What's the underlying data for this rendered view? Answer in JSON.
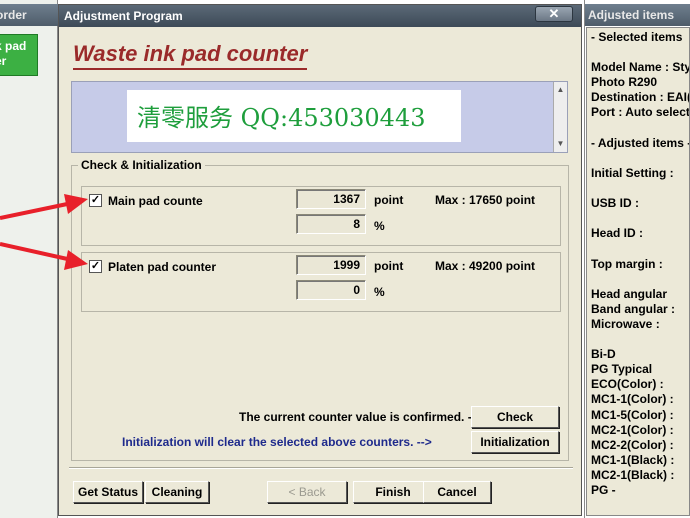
{
  "left_window": {
    "title": "order",
    "green_button_lines": [
      "k pad",
      "er"
    ]
  },
  "dialog": {
    "title": "Adjustment Program",
    "close_glyph": "✕",
    "heading": "Waste ink pad counter",
    "info_text": "清零服务 QQ:453030443",
    "check_group_label": "Check & Initialization",
    "main_pad": {
      "checked": true,
      "label": "Main pad counte",
      "point_value": "1367",
      "point_unit": "point",
      "percent_value": "8",
      "percent_unit": "%",
      "max": "Max : 17650 point"
    },
    "platen_pad": {
      "checked": true,
      "label": "Platen pad counter",
      "point_value": "1999",
      "point_unit": "point",
      "percent_value": "0",
      "percent_unit": "%",
      "max": "Max : 49200 point"
    },
    "confirm_text": "The current counter value is confirmed. -->",
    "init_text": "Initialization will clear the selected above counters. -->",
    "buttons": {
      "check": "Check",
      "initialization": "Initialization",
      "get_status": "Get Status",
      "cleaning": "Cleaning",
      "back": "< Back",
      "finish": "Finish",
      "cancel": "Cancel"
    }
  },
  "right_window": {
    "title": "Adjusted items",
    "lines": [
      "- Selected items",
      "Model Name : Sty",
      "Photo R290",
      "Destination : EAI(",
      "Port : Auto select",
      "- Adjusted items -",
      "Initial Setting :",
      "USB ID :",
      "Head ID :",
      "Top margin :",
      "Head angular",
      "Band angular :",
      "Microwave :",
      "Bi-D",
      "PG Typical",
      " ECO(Color) :",
      " MC1-1(Color) :",
      " MC1-5(Color) :",
      " MC2-1(Color) :",
      " MC2-2(Color) :",
      " MC1-1(Black) :",
      " MC2-1(Black) :",
      "PG -"
    ]
  },
  "colors": {
    "heading": "#9a2a2a",
    "info_text": "#1e9e3c",
    "init_text": "#1e2a8c",
    "arrow": "#e8202a"
  }
}
